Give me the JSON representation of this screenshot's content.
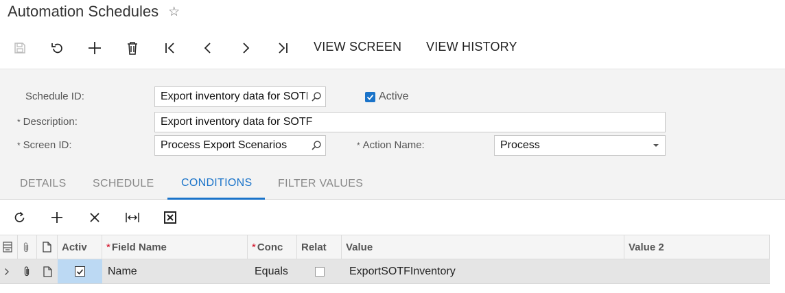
{
  "page": {
    "title": "Automation Schedules",
    "favorite_icon": "star-outline-icon"
  },
  "toolbar": {
    "icons": [
      "save-icon",
      "undo-icon",
      "add-icon",
      "delete-icon",
      "first-record-icon",
      "previous-record-icon",
      "next-record-icon",
      "last-record-icon"
    ],
    "view_screen": "VIEW SCREEN",
    "view_history": "VIEW HISTORY"
  },
  "form": {
    "schedule_id_label": "Schedule ID:",
    "schedule_id_value": "Export inventory data for SOTF",
    "active_label": "Active",
    "active_checked": true,
    "description_label": "Description:",
    "description_value": "Export inventory data for SOTF",
    "screen_id_label": "Screen ID:",
    "screen_id_value": "Process Export Scenarios",
    "action_name_label": "Action Name:",
    "action_name_value": "Process",
    "required_mark": "*"
  },
  "tabs": [
    {
      "label": "DETAILS",
      "active": false
    },
    {
      "label": "SCHEDULE",
      "active": false
    },
    {
      "label": "CONDITIONS",
      "active": true
    },
    {
      "label": "FILTER VALUES",
      "active": false
    }
  ],
  "grid_toolbar": {
    "icons": [
      "refresh-icon",
      "add-row-icon",
      "delete-row-icon",
      "fit-columns-icon",
      "export-excel-icon"
    ]
  },
  "grid": {
    "columns": [
      "Activ",
      "Field Name",
      "Conc",
      "Relat",
      "Value",
      "Value 2"
    ],
    "rows": [
      {
        "active": true,
        "field_name": "Name",
        "condition": "Equals",
        "relative": false,
        "value": "ExportSOTFInventory",
        "value2": ""
      }
    ]
  },
  "colors": {
    "accent": "#1a73c9",
    "required": "#d0021b",
    "selected_cell": "#bcd9f3"
  }
}
